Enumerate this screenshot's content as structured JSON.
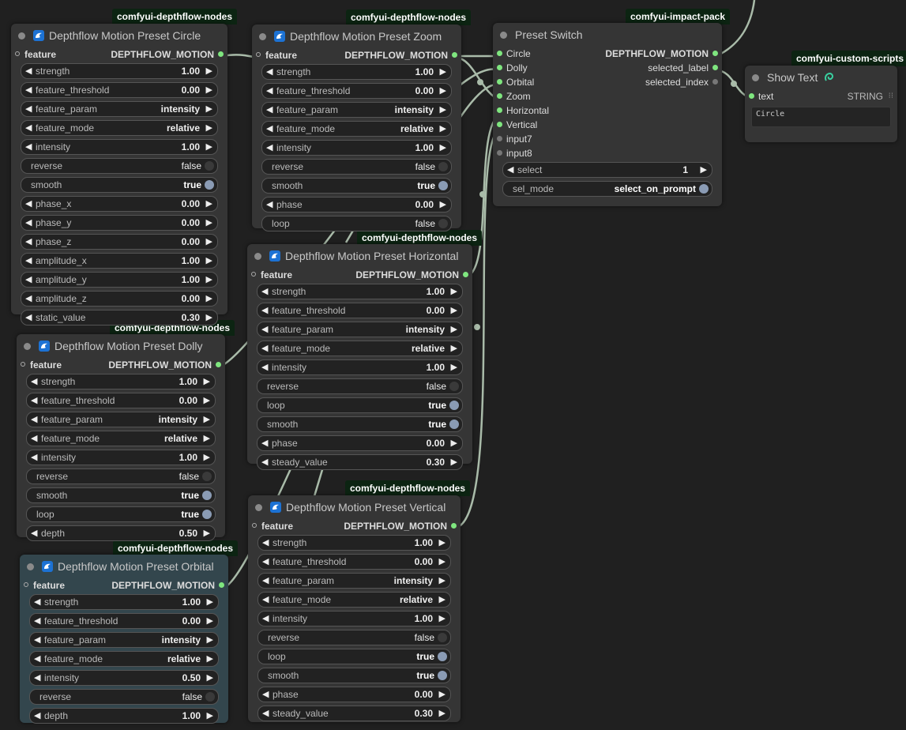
{
  "pack_labels": {
    "depthflow": "comfyui-depthflow-nodes",
    "impact": "comfyui-impact-pack",
    "custom_scripts": "comfyui-custom-scripts"
  },
  "io": {
    "feature": "feature",
    "depthflow_motion": "DEPTHFLOW_MOTION",
    "text": "text",
    "string": "STRING",
    "selected_label": "selected_label",
    "selected_index": "selected_index",
    "input7": "input7",
    "input8": "input8"
  },
  "arrows": {
    "left": "◀",
    "right": "▶"
  },
  "nodes": {
    "circle": {
      "title": "Depthflow Motion Preset Circle",
      "widgets": [
        {
          "label": "strength",
          "value": "1.00"
        },
        {
          "label": "feature_threshold",
          "value": "0.00"
        },
        {
          "label": "feature_param",
          "value": "intensity"
        },
        {
          "label": "feature_mode",
          "value": "relative"
        },
        {
          "label": "intensity",
          "value": "1.00"
        },
        {
          "label": "reverse",
          "value": "false"
        },
        {
          "label": "smooth",
          "value": "true"
        },
        {
          "label": "phase_x",
          "value": "0.00"
        },
        {
          "label": "phase_y",
          "value": "0.00"
        },
        {
          "label": "phase_z",
          "value": "0.00"
        },
        {
          "label": "amplitude_x",
          "value": "1.00"
        },
        {
          "label": "amplitude_y",
          "value": "1.00"
        },
        {
          "label": "amplitude_z",
          "value": "0.00"
        },
        {
          "label": "static_value",
          "value": "0.30"
        }
      ]
    },
    "zoom": {
      "title": "Depthflow Motion Preset Zoom",
      "widgets": [
        {
          "label": "strength",
          "value": "1.00"
        },
        {
          "label": "feature_threshold",
          "value": "0.00"
        },
        {
          "label": "feature_param",
          "value": "intensity"
        },
        {
          "label": "feature_mode",
          "value": "relative"
        },
        {
          "label": "intensity",
          "value": "1.00"
        },
        {
          "label": "reverse",
          "value": "false"
        },
        {
          "label": "smooth",
          "value": "true"
        },
        {
          "label": "phase",
          "value": "0.00"
        },
        {
          "label": "loop",
          "value": "false"
        }
      ]
    },
    "switch": {
      "title": "Preset Switch",
      "inputs": [
        "Circle",
        "Dolly",
        "Orbital",
        "Zoom",
        "Horizontal",
        "Vertical"
      ],
      "select_label": "select",
      "select_value": "1",
      "sel_mode_label": "sel_mode",
      "sel_mode_value": "select_on_prompt"
    },
    "showtext": {
      "title": "Show Text",
      "content": "Circle"
    },
    "horizontal": {
      "title": "Depthflow Motion Preset Horizontal",
      "widgets": [
        {
          "label": "strength",
          "value": "1.00"
        },
        {
          "label": "feature_threshold",
          "value": "0.00"
        },
        {
          "label": "feature_param",
          "value": "intensity"
        },
        {
          "label": "feature_mode",
          "value": "relative"
        },
        {
          "label": "intensity",
          "value": "1.00"
        },
        {
          "label": "reverse",
          "value": "false"
        },
        {
          "label": "loop",
          "value": "true"
        },
        {
          "label": "smooth",
          "value": "true"
        },
        {
          "label": "phase",
          "value": "0.00"
        },
        {
          "label": "steady_value",
          "value": "0.30"
        }
      ]
    },
    "dolly": {
      "title": "Depthflow Motion Preset Dolly",
      "widgets": [
        {
          "label": "strength",
          "value": "1.00"
        },
        {
          "label": "feature_threshold",
          "value": "0.00"
        },
        {
          "label": "feature_param",
          "value": "intensity"
        },
        {
          "label": "feature_mode",
          "value": "relative"
        },
        {
          "label": "intensity",
          "value": "1.00"
        },
        {
          "label": "reverse",
          "value": "false"
        },
        {
          "label": "smooth",
          "value": "true"
        },
        {
          "label": "loop",
          "value": "true"
        },
        {
          "label": "depth",
          "value": "0.50"
        }
      ]
    },
    "orbital": {
      "title": "Depthflow Motion Preset Orbital",
      "widgets": [
        {
          "label": "strength",
          "value": "1.00"
        },
        {
          "label": "feature_threshold",
          "value": "0.00"
        },
        {
          "label": "feature_param",
          "value": "intensity"
        },
        {
          "label": "feature_mode",
          "value": "relative"
        },
        {
          "label": "intensity",
          "value": "0.50"
        },
        {
          "label": "reverse",
          "value": "false"
        },
        {
          "label": "depth",
          "value": "1.00"
        }
      ]
    },
    "vertical": {
      "title": "Depthflow Motion Preset Vertical",
      "widgets": [
        {
          "label": "strength",
          "value": "1.00"
        },
        {
          "label": "feature_threshold",
          "value": "0.00"
        },
        {
          "label": "feature_param",
          "value": "intensity"
        },
        {
          "label": "feature_mode",
          "value": "relative"
        },
        {
          "label": "intensity",
          "value": "1.00"
        },
        {
          "label": "reverse",
          "value": "false"
        },
        {
          "label": "loop",
          "value": "true"
        },
        {
          "label": "smooth",
          "value": "true"
        },
        {
          "label": "phase",
          "value": "0.00"
        },
        {
          "label": "steady_value",
          "value": "0.30"
        }
      ]
    }
  },
  "colors": {
    "canvas": "#202020",
    "node": "#353535",
    "node_selected": "#33464d",
    "wire": "#a9bba9",
    "port_active": "#7fe67f",
    "pack_badge": "#0c2412"
  },
  "icons": {
    "node_status": "dot-icon",
    "depthflow_logo": "wave-logo-icon",
    "custom_scripts_logo": "snake-logo-icon"
  }
}
